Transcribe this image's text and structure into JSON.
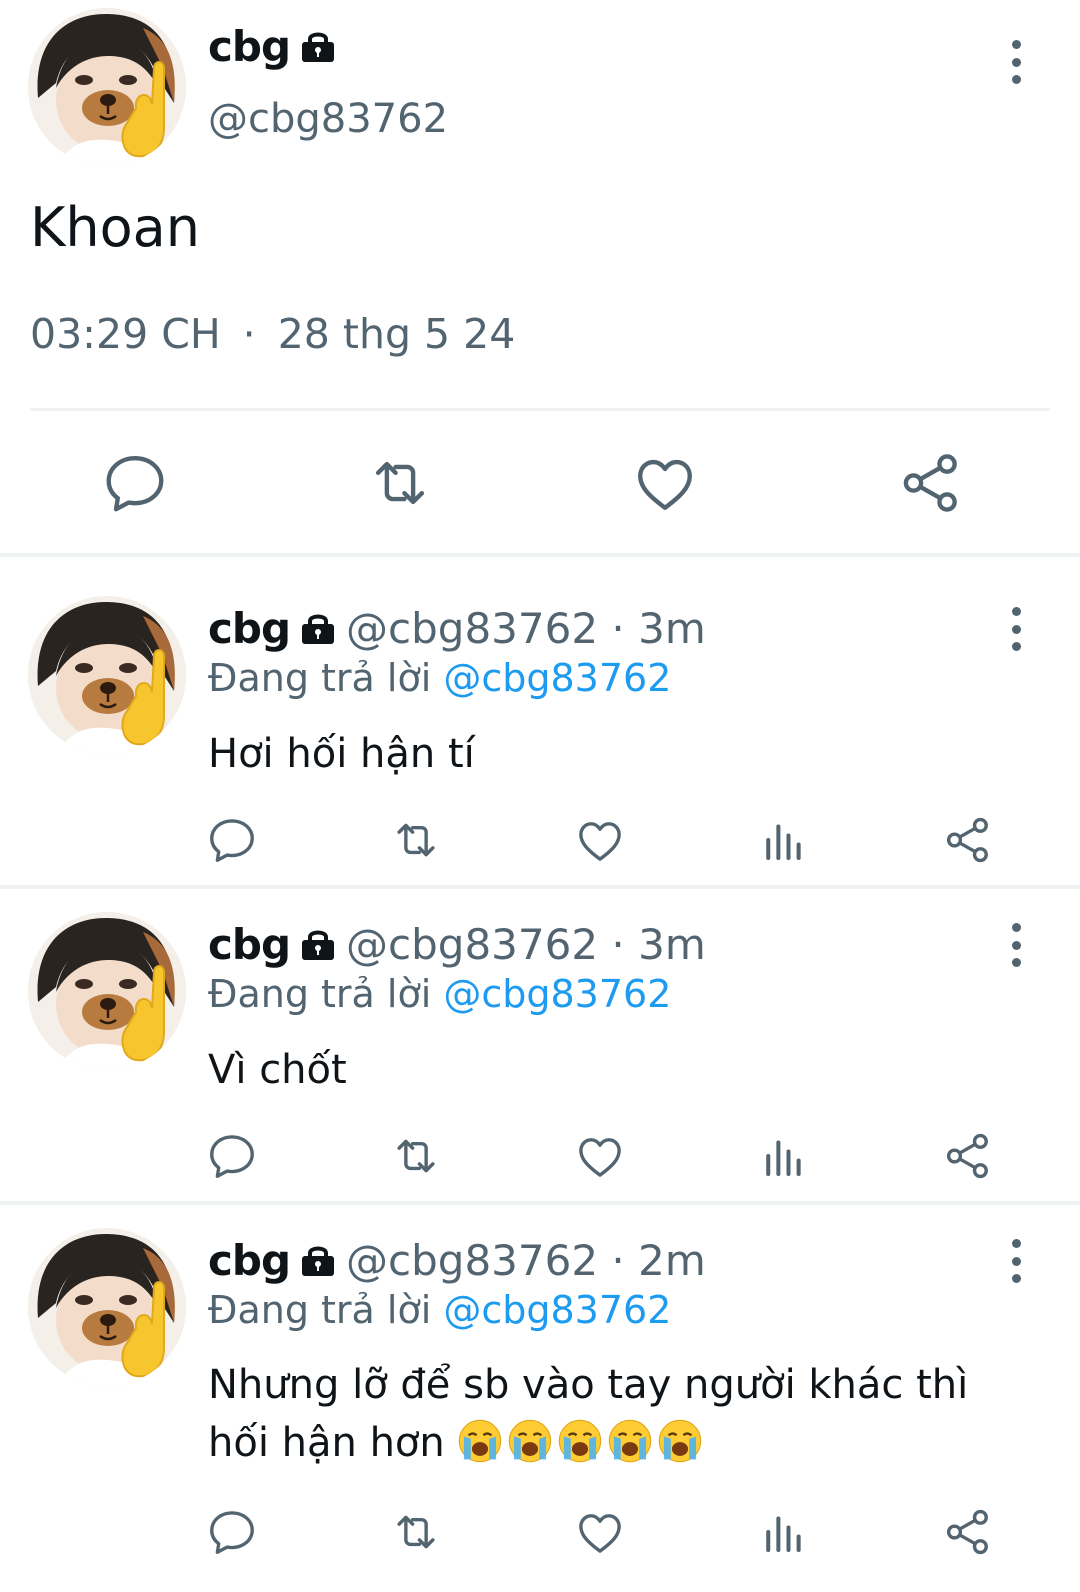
{
  "colors": {
    "text": "#0f1419",
    "secondary": "#536471",
    "link": "#1d9bf0",
    "divider": "#eff3f4"
  },
  "main_tweet": {
    "name": "cbg",
    "handle": "@cbg83762",
    "text": "Khoan",
    "time": "03:29 CH",
    "separator": "·",
    "date": "28 thg 5 24",
    "actions": [
      "reply-icon",
      "retweet-icon",
      "like-icon",
      "share-icon"
    ]
  },
  "replies": [
    {
      "name": "cbg",
      "handle": "@cbg83762 · 3m",
      "replying_label": "Đang trả lời",
      "replying_to": "@cbg83762",
      "text": "Hơi hối hận tí"
    },
    {
      "name": "cbg",
      "handle": "@cbg83762 · 3m",
      "replying_label": "Đang trả lời",
      "replying_to": "@cbg83762",
      "text": "Vì chốt"
    },
    {
      "name": "cbg",
      "handle": "@cbg83762 · 2m",
      "replying_label": "Đang trả lời",
      "replying_to": "@cbg83762",
      "text": "Nhưng lỡ để sb vào tay người khác thì hối hận hơn",
      "emoji": "loudly-crying-face-icon ×5"
    }
  ],
  "reply_actions": [
    "reply-icon",
    "retweet-icon",
    "like-icon",
    "views-icon",
    "share-icon"
  ]
}
